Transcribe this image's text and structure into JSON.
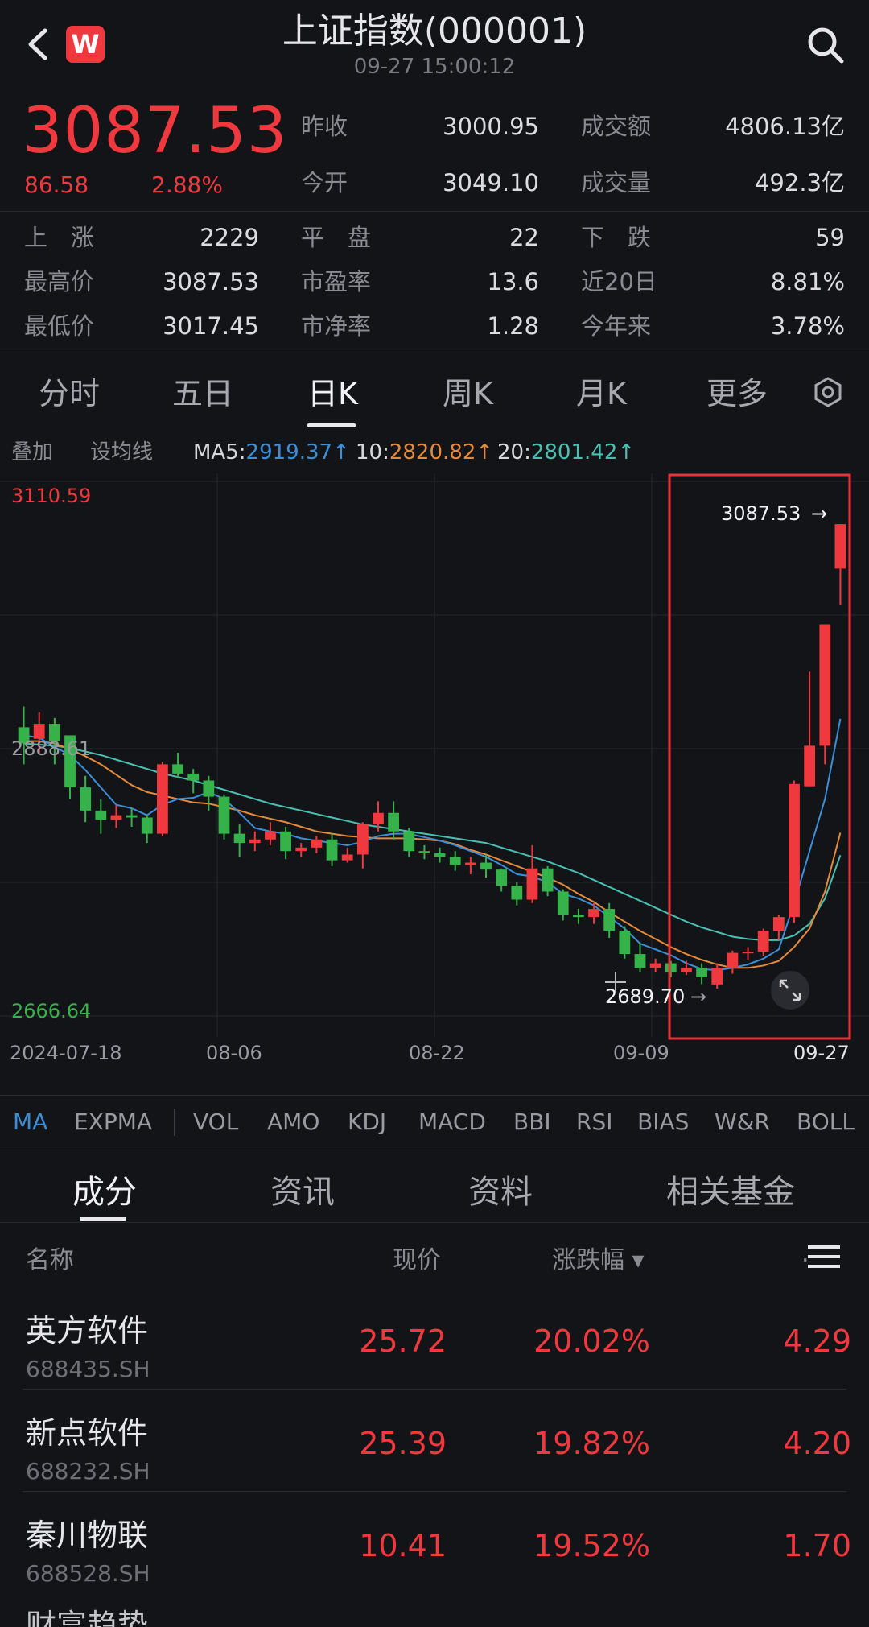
{
  "header": {
    "title": "上证指数(000001)",
    "time": "09-27 15:00:12",
    "logo_text": "W",
    "colors": {
      "up": "#f0393e",
      "down": "#35b34a",
      "bg": "#131417"
    }
  },
  "quote": {
    "price": "3087.53",
    "change": "86.58",
    "change_pct": "2.88%",
    "stats": [
      [
        {
          "label": "昨收",
          "value": "3000.95"
        },
        {
          "label": "成交额",
          "value": "4806.13亿"
        }
      ],
      [
        {
          "label": "今开",
          "value": "3049.10"
        },
        {
          "label": "成交量",
          "value": "492.3亿"
        }
      ]
    ],
    "grid": [
      [
        {
          "label": "上　涨",
          "value": "2229"
        },
        {
          "label": "平　盘",
          "value": "22"
        },
        {
          "label": "下　跌",
          "value": "59"
        }
      ],
      [
        {
          "label": "最高价",
          "value": "3087.53"
        },
        {
          "label": "市盈率",
          "value": "13.6"
        },
        {
          "label": "近20日",
          "value": "8.81%"
        }
      ],
      [
        {
          "label": "最低价",
          "value": "3017.45"
        },
        {
          "label": "市净率",
          "value": "1.28"
        },
        {
          "label": "今年来",
          "value": "3.78%"
        }
      ]
    ]
  },
  "tabs": [
    "分时",
    "五日",
    "日K",
    "周K",
    "月K",
    "更多"
  ],
  "ma": {
    "overlay": "叠加",
    "settings": "设均线",
    "ma5_label": "MA5:",
    "ma5": "2919.37",
    "ma10_label": "10:",
    "ma10": "2820.82",
    "ma20_label": "20:",
    "ma20": "2801.42",
    "arrow": "↑"
  },
  "chart_data": {
    "type": "candlestick",
    "y_top_label": "3110.59",
    "y_mid_label": "2888.61",
    "y_bottom_label": "2666.64",
    "ylim": [
      2666.64,
      3110.59
    ],
    "high_marker": "3087.53",
    "low_marker": "2689.70",
    "x_labels": [
      "2024-07-18",
      "08-06",
      "08-22",
      "09-09",
      "09-27"
    ],
    "candles": [
      [
        2912,
        2898,
        2930,
        2880
      ],
      [
        2902,
        2915,
        2925,
        2890
      ],
      [
        2915,
        2900,
        2920,
        2880
      ],
      [
        2905,
        2860,
        2905,
        2850
      ],
      [
        2860,
        2840,
        2870,
        2830
      ],
      [
        2840,
        2832,
        2850,
        2820
      ],
      [
        2832,
        2836,
        2845,
        2825
      ],
      [
        2836,
        2834,
        2842,
        2826
      ],
      [
        2834,
        2820,
        2836,
        2812
      ],
      [
        2820,
        2880,
        2882,
        2818
      ],
      [
        2880,
        2872,
        2890,
        2868
      ],
      [
        2872,
        2866,
        2876,
        2855
      ],
      [
        2866,
        2852,
        2870,
        2840
      ],
      [
        2852,
        2820,
        2854,
        2815
      ],
      [
        2820,
        2812,
        2828,
        2800
      ],
      [
        2812,
        2815,
        2822,
        2805
      ],
      [
        2815,
        2822,
        2830,
        2810
      ],
      [
        2822,
        2805,
        2826,
        2798
      ],
      [
        2805,
        2808,
        2812,
        2800
      ],
      [
        2808,
        2815,
        2818,
        2803
      ],
      [
        2815,
        2797,
        2820,
        2792
      ],
      [
        2797,
        2802,
        2808,
        2795
      ],
      [
        2802,
        2828,
        2830,
        2790
      ],
      [
        2828,
        2838,
        2848,
        2822
      ],
      [
        2838,
        2822,
        2848,
        2815
      ],
      [
        2822,
        2805,
        2825,
        2800
      ],
      [
        2805,
        2803,
        2810,
        2798
      ],
      [
        2803,
        2800,
        2808,
        2795
      ],
      [
        2800,
        2793,
        2805,
        2788
      ],
      [
        2793,
        2795,
        2800,
        2785
      ],
      [
        2795,
        2789,
        2802,
        2782
      ],
      [
        2789,
        2775,
        2790,
        2770
      ],
      [
        2775,
        2763,
        2778,
        2758
      ],
      [
        2763,
        2790,
        2810,
        2760
      ],
      [
        2790,
        2770,
        2792,
        2766
      ],
      [
        2770,
        2750,
        2772,
        2745
      ],
      [
        2750,
        2748,
        2755,
        2742
      ],
      [
        2748,
        2755,
        2760,
        2742
      ],
      [
        2755,
        2736,
        2760,
        2730
      ],
      [
        2736,
        2716,
        2740,
        2712
      ],
      [
        2716,
        2704,
        2726,
        2700
      ],
      [
        2704,
        2708,
        2712,
        2700
      ],
      [
        2708,
        2700,
        2710,
        2696
      ],
      [
        2700,
        2704,
        2710,
        2698
      ],
      [
        2704,
        2696,
        2708,
        2690
      ],
      [
        2689.7,
        2704,
        2708,
        2686
      ],
      [
        2704,
        2717,
        2719,
        2699
      ],
      [
        2717,
        2718,
        2722,
        2711
      ],
      [
        2718,
        2736,
        2738,
        2714
      ],
      [
        2736,
        2748,
        2750,
        2728
      ],
      [
        2748,
        2863,
        2866,
        2743
      ],
      [
        2861,
        2896,
        2960,
        2861
      ],
      [
        2896,
        3001,
        3001,
        2880
      ],
      [
        3049.1,
        3087.53,
        3087.53,
        3017.45
      ]
    ],
    "ma5": [
      2905,
      2903,
      2895,
      2888,
      2875,
      2860,
      2845,
      2842,
      2836,
      2845,
      2850,
      2851,
      2856,
      2850,
      2838,
      2825,
      2822,
      2820,
      2816,
      2814,
      2812,
      2810,
      2813,
      2818,
      2820,
      2820,
      2817,
      2814,
      2810,
      2805,
      2800,
      2793,
      2785,
      2783,
      2778,
      2768,
      2764,
      2758,
      2748,
      2738,
      2725,
      2720,
      2715,
      2708,
      2703,
      2702,
      2704,
      2707,
      2712,
      2720,
      2760,
      2805,
      2850,
      2919.37
    ],
    "ma10": [
      2900,
      2900,
      2898,
      2893,
      2887,
      2880,
      2871,
      2862,
      2856,
      2853,
      2850,
      2847,
      2846,
      2843,
      2840,
      2836,
      2833,
      2830,
      2826,
      2822,
      2820,
      2818,
      2817,
      2816,
      2816,
      2816,
      2815,
      2814,
      2811,
      2806,
      2802,
      2797,
      2792,
      2787,
      2782,
      2776,
      2768,
      2761,
      2752,
      2744,
      2736,
      2729,
      2722,
      2716,
      2711,
      2707,
      2704,
      2704,
      2706,
      2710,
      2722,
      2738,
      2770,
      2820.82
    ],
    "ma20": [
      2898,
      2897,
      2896,
      2894,
      2891,
      2888,
      2884,
      2880,
      2876,
      2872,
      2869,
      2866,
      2862,
      2858,
      2854,
      2850,
      2846,
      2843,
      2840,
      2837,
      2834,
      2831,
      2828,
      2826,
      2824,
      2822,
      2820,
      2818,
      2816,
      2814,
      2812,
      2808,
      2804,
      2800,
      2796,
      2791,
      2786,
      2780,
      2774,
      2768,
      2762,
      2756,
      2750,
      2744,
      2739,
      2735,
      2731,
      2729,
      2728,
      2728,
      2732,
      2742,
      2764,
      2801.42
    ]
  },
  "indicators": [
    "MA",
    "EXPMA",
    "VOL",
    "AMO",
    "KDJ",
    "MACD",
    "BBI",
    "RSI",
    "BIAS",
    "W&R",
    "BOLL"
  ],
  "bottom_tabs": [
    "成分",
    "资讯",
    "资料",
    "相关基金"
  ],
  "table": {
    "headers": {
      "name": "名称",
      "price": "现价",
      "change": "涨跌幅 ▾",
      "col4": "."
    },
    "rows": [
      {
        "name": "英方软件",
        "code": "688435.SH",
        "price": "25.72",
        "change": "20.02%",
        "col4": "4.29"
      },
      {
        "name": "新点软件",
        "code": "688232.SH",
        "price": "25.39",
        "change": "19.82%",
        "col4": "4.20"
      },
      {
        "name": "秦川物联",
        "code": "688528.SH",
        "price": "10.41",
        "change": "19.52%",
        "col4": "1.70"
      },
      {
        "name": "财富趋势",
        "code": "",
        "price": "",
        "change": "",
        "col4": ""
      }
    ]
  }
}
